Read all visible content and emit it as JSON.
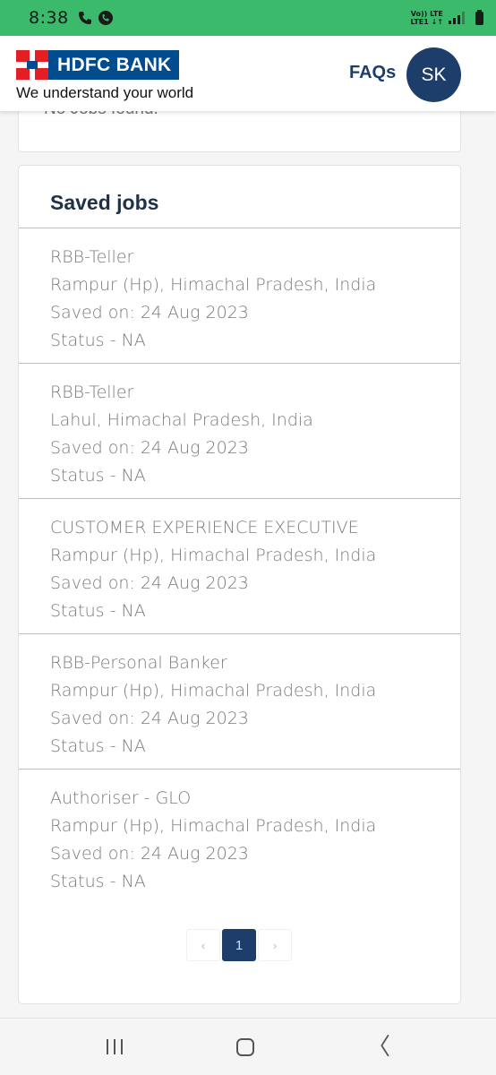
{
  "status_bar": {
    "time": "8:38",
    "network_top": "Vo)) LTE",
    "network_bottom": "LTE1 ↓↑"
  },
  "header": {
    "brand": "HDFC BANK",
    "tagline": "We understand your world",
    "faqs_label": "FAQs",
    "avatar_initials": "SK"
  },
  "previous_section": {
    "message": "No Jobs found."
  },
  "saved_jobs": {
    "title": "Saved jobs",
    "items": [
      {
        "title": "RBB-Teller",
        "location": "Rampur (Hp), Himachal Pradesh, India",
        "saved_on": "Saved on: 24 Aug 2023",
        "status": "Status - NA"
      },
      {
        "title": "RBB-Teller",
        "location": "Lahul, Himachal Pradesh, India",
        "saved_on": "Saved on: 24 Aug 2023",
        "status": "Status - NA"
      },
      {
        "title": "CUSTOMER EXPERIENCE EXECUTIVE",
        "location": "Rampur (Hp), Himachal Pradesh, India",
        "saved_on": "Saved on: 24 Aug 2023",
        "status": "Status - NA"
      },
      {
        "title": "RBB-Personal Banker",
        "location": "Rampur (Hp), Himachal Pradesh, India",
        "saved_on": "Saved on: 24 Aug 2023",
        "status": "Status - NA"
      },
      {
        "title": "Authoriser - GLO",
        "location": "Rampur (Hp), Himachal Pradesh, India",
        "saved_on": "Saved on: 24 Aug 2023",
        "status": "Status - NA"
      }
    ]
  },
  "pagination": {
    "prev": "‹",
    "current": "1",
    "next": "›"
  },
  "nav": {
    "recent_icon": "recent-apps-icon",
    "home_icon": "home-icon",
    "back_icon": "back-icon",
    "back_glyph": "〈"
  },
  "colors": {
    "status_bar": "#3cba6b",
    "brand_blue": "#004c8f",
    "brand_red": "#e31e24",
    "navy": "#1d3d6b"
  }
}
